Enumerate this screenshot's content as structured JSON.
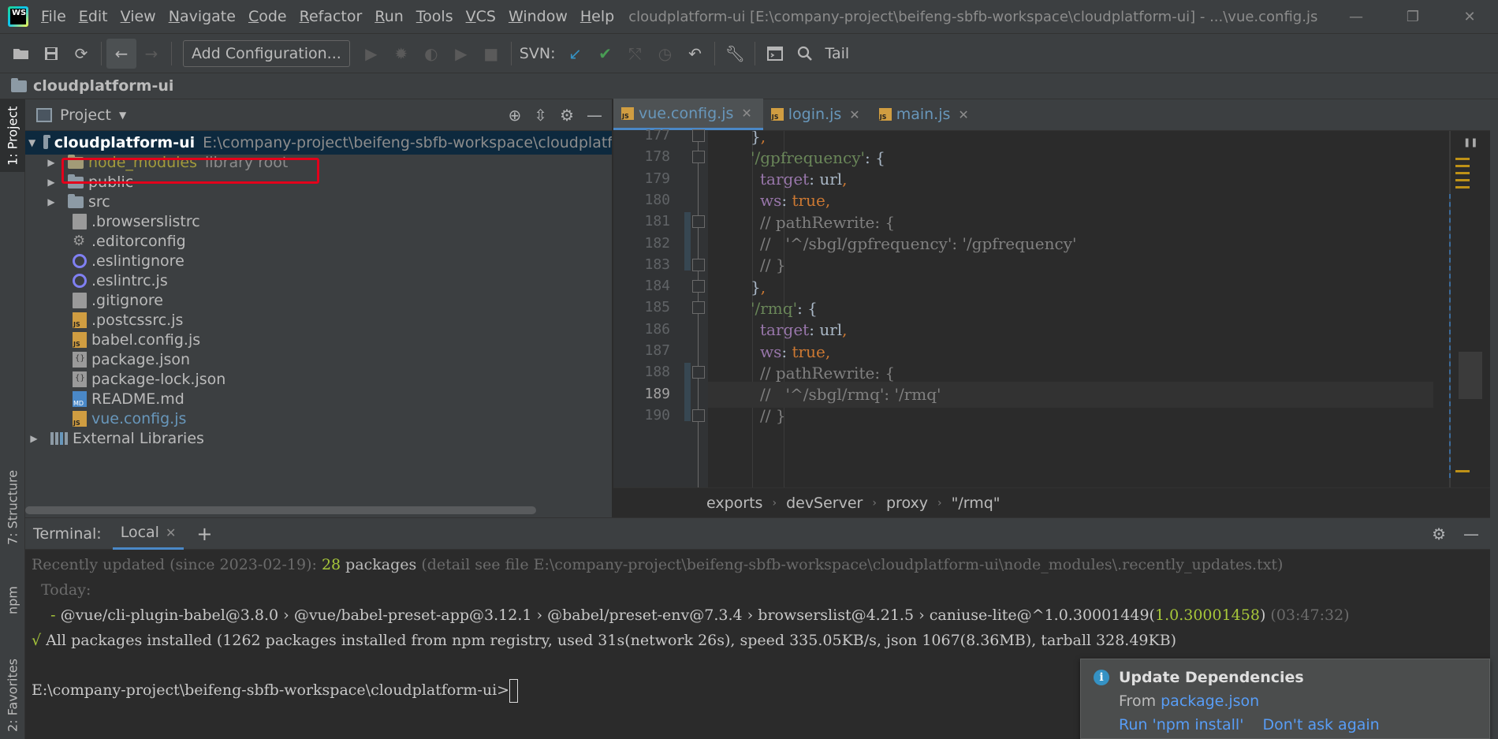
{
  "menu": {
    "items": [
      "File",
      "Edit",
      "View",
      "Navigate",
      "Code",
      "Refactor",
      "Run",
      "Tools",
      "VCS",
      "Window",
      "Help"
    ],
    "window_title": "cloudplatform-ui [E:\\company-project\\beifeng-sbfb-workspace\\cloudplatform-ui] - ...\\vue.config.js",
    "logo_text": "WS"
  },
  "toolbar": {
    "add_config_label": "Add Configuration...",
    "svn_label": "SVN:",
    "tail_label": "Tail"
  },
  "navbar": {
    "project_name": "cloudplatform-ui"
  },
  "left_strip": {
    "tabs": [
      "1: Project",
      "7: Structure",
      "npm",
      "2: Favorites"
    ]
  },
  "project_panel": {
    "title": "Project",
    "root": {
      "name": "cloudplatform-ui",
      "path": "E:\\company-project\\beifeng-sbfb-workspace\\cloudplatf"
    },
    "items": [
      {
        "name": "node_modules",
        "hint": "library root",
        "kind": "lib-folder",
        "expandable": true
      },
      {
        "name": "public",
        "kind": "folder",
        "expandable": true
      },
      {
        "name": "src",
        "kind": "folder",
        "expandable": true
      },
      {
        "name": ".browserslistrc",
        "kind": "file"
      },
      {
        "name": ".editorconfig",
        "kind": "gear"
      },
      {
        "name": ".eslintignore",
        "kind": "eslint"
      },
      {
        "name": ".eslintrc.js",
        "kind": "eslint"
      },
      {
        "name": ".gitignore",
        "kind": "file"
      },
      {
        "name": ".postcssrc.js",
        "kind": "js"
      },
      {
        "name": "babel.config.js",
        "kind": "js"
      },
      {
        "name": "package.json",
        "kind": "json"
      },
      {
        "name": "package-lock.json",
        "kind": "json"
      },
      {
        "name": "README.md",
        "kind": "md"
      },
      {
        "name": "vue.config.js",
        "kind": "js",
        "modified": true
      },
      {
        "name": "External Libraries",
        "kind": "libs",
        "expandable": true
      }
    ]
  },
  "editor": {
    "tabs": [
      {
        "label": "vue.config.js",
        "active": true
      },
      {
        "label": "login.js",
        "active": false
      },
      {
        "label": "main.js",
        "active": false
      }
    ],
    "lines": [
      {
        "n": "177",
        "text": "},"
      },
      {
        "n": "178",
        "text": "'/gpfrequency': {"
      },
      {
        "n": "179",
        "text": "target: url,"
      },
      {
        "n": "180",
        "text": "ws: true,"
      },
      {
        "n": "181",
        "text": "// pathRewrite: {"
      },
      {
        "n": "182",
        "text": "//   '^/sbgl/gpfrequency': '/gpfrequency'"
      },
      {
        "n": "183",
        "text": "// }"
      },
      {
        "n": "184",
        "text": "},"
      },
      {
        "n": "185",
        "text": "'/rmq': {"
      },
      {
        "n": "186",
        "text": "target: url,"
      },
      {
        "n": "187",
        "text": "ws: true,"
      },
      {
        "n": "188",
        "text": "// pathRewrite: {"
      },
      {
        "n": "189",
        "text": "//   '^/sbgl/rmq': '/rmq'"
      },
      {
        "n": "190",
        "text": "// }"
      }
    ],
    "current_line": "189",
    "breadcrumb": [
      "exports",
      "devServer",
      "proxy",
      "\"/rmq\""
    ]
  },
  "terminal": {
    "title": "Terminal:",
    "tab": "Local",
    "lines": {
      "l1_a": "Recently updated (since 2023-02-19): ",
      "l1_count": "28",
      "l1_b": " packages",
      "l1_c": " (detail see file E:\\company-project\\beifeng-sbfb-workspace\\cloudplatform-ui\\node_modules\\.recently_updates.txt)",
      "l2": "  Today:",
      "l3_a": "    - ",
      "l3_b": "@vue/cli-plugin-babel@3.8.0 › @vue/babel-preset-app@3.12.1 › @babel/preset-env@7.3.4 › browserslist@4.21.5 › caniuse-lite@^1.0.30001449(",
      "l3_new": "1.0.30001458",
      "l3_c": ")",
      "l3_time": " (03:47:32)",
      "l4_mark": "√",
      "l4": " All packages installed (1262 packages installed from npm registry, used 31s(network 26s), speed 335.05KB/s, json 1067(8.36MB), tarball 328.49KB)",
      "prompt": "E:\\company-project\\beifeng-sbfb-workspace\\cloudplatform-ui>"
    }
  },
  "notification": {
    "title": "Update Dependencies",
    "from_label": "From ",
    "from_link": "package.json",
    "action_install": "Run 'npm install'",
    "action_dismiss": "Don't ask again"
  }
}
